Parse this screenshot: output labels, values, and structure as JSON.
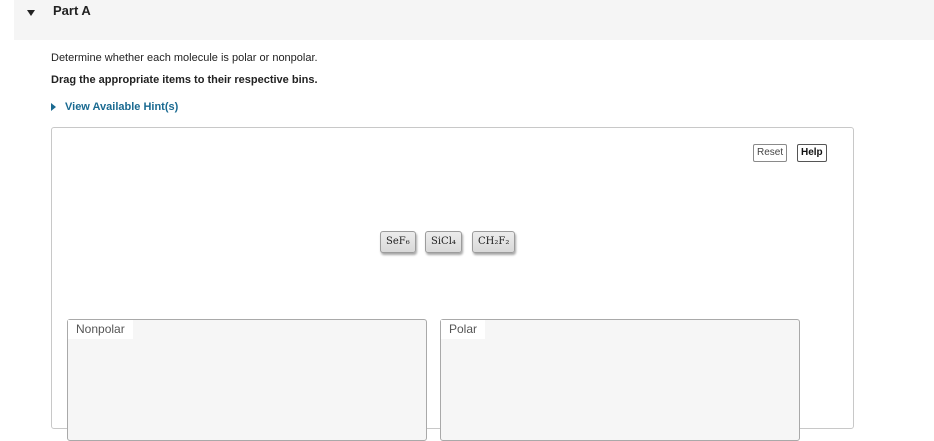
{
  "part": {
    "title": "Part A"
  },
  "question": {
    "instruction": "Determine whether each molecule is polar or nonpolar.",
    "drag_instruction": "Drag the appropriate items to their respective bins.",
    "hint_label": "View Available Hint(s)"
  },
  "toolbar": {
    "reset_label": "Reset",
    "help_label": "Help"
  },
  "tokens": [
    {
      "label": "SeF₆"
    },
    {
      "label": "SiCl₄"
    },
    {
      "label": "CH₂F₂"
    }
  ],
  "bins": [
    {
      "label": "Nonpolar"
    },
    {
      "label": "Polar"
    }
  ],
  "colors": {
    "link": "#1a6a91",
    "header_bg": "#f5f5f5",
    "bin_bg": "#f6f6f6"
  }
}
